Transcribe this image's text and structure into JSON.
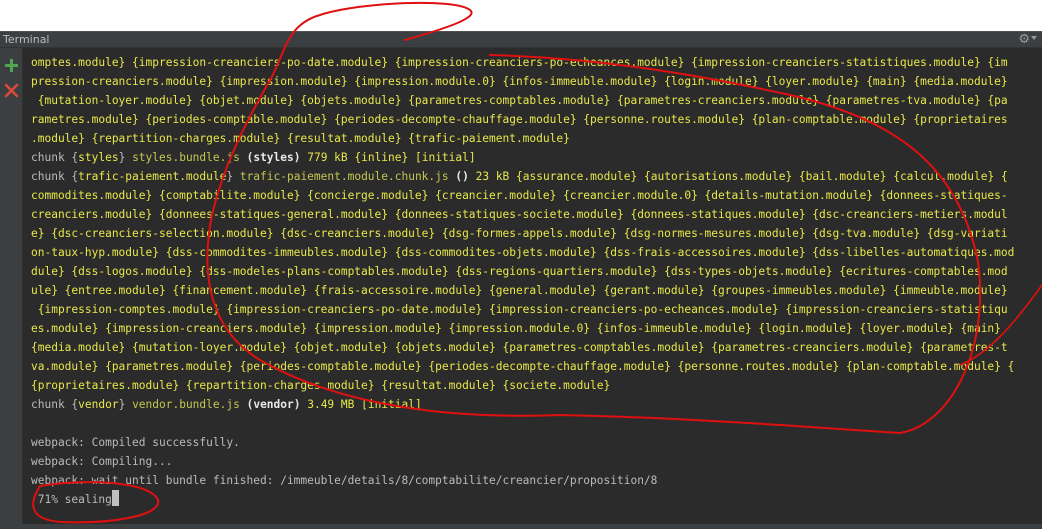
{
  "panel": {
    "title": "Terminal"
  },
  "toolbar": {
    "new_icon": "plus-icon",
    "close_icon": "close-icon",
    "settings_icon": "gear-icon"
  },
  "colors": {
    "terminal_bg": "#2b2b2b",
    "panel_bg": "#3c3f41",
    "module_text": "#e8e84a",
    "plain_text": "#bbbbbb",
    "add_green": "#4ea64e",
    "close_red": "#d94a3a",
    "annotation_red": "#e01010"
  },
  "output": {
    "l01": "omptes.module} {impression-creanciers-po-date.module} {impression-creanciers-po-echeances.module} {impression-creanciers-statistiques.module} {im",
    "l02": "pression-creanciers.module} {impression.module} {impression.module.0} {infos-immeuble.module} {login.module} {loyer.module} {main} {media.module}",
    "l03": " {mutation-loyer.module} {objet.module} {objets.module} {parametres-comptables.module} {parametres-creanciers.module} {parametres-tva.module} {pa",
    "l04": "rametres.module} {periodes-comptable.module} {periodes-decompte-chauffage.module} {personne.routes.module} {plan-comptable.module} {proprietaires",
    "l05": ".module} {repartition-charges.module} {resultat.module} {trafic-paiement.module}",
    "l06": {
      "p1": "chunk {",
      "p2": "styles",
      "p3": "} ",
      "p4": "styles.bundle.js",
      "p5": " ",
      "p6": "(styles)",
      "p7": " 779 kB {inline} [initial]"
    },
    "l07": {
      "p1": "chunk {",
      "p2": "trafic-paiement.module",
      "p3": "} ",
      "p4": "trafic-paiement.module.chunk.js",
      "p5": " ",
      "p6": "()",
      "p7": " 23 kB {assurance.module} {autorisations.module} {bail.module} {calcul.module} {"
    },
    "l08": "commodites.module} {comptabilite.module} {concierge.module} {creancier.module} {creancier.module.0} {details-mutation.module} {donnees-statiques-",
    "l09": "creanciers.module} {donnees-statiques-general.module} {donnees-statiques-societe.module} {donnees-statiques.module} {dsc-creanciers-metiers.modul",
    "l10": "e} {dsc-creanciers-selection.module} {dsc-creanciers.module} {dsg-formes-appels.module} {dsg-normes-mesures.module} {dsg-tva.module} {dsg-variati",
    "l11": "on-taux-hyp.module} {dss-commodites-immeubles.module} {dss-commodites-objets.module} {dss-frais-accessoires.module} {dss-libelles-automatiques.mod",
    "l12": "dule} {dss-logos.module} {dss-modeles-plans-comptables.module} {dss-regions-quartiers.module} {dss-types-objets.module} {ecritures-comptables.mod",
    "l13": "ule} {entree.module} {financement.module} {frais-accessoire.module} {general.module} {gerant.module} {groupes-immeubles.module} {immeuble.module}",
    "l14": " {impression-comptes.module} {impression-creanciers-po-date.module} {impression-creanciers-po-echeances.module} {impression-creanciers-statistiqu",
    "l15": "es.module} {impression-creanciers.module} {impression.module} {impression.module.0} {infos-immeuble.module} {login.module} {loyer.module} {main}",
    "l16": "{media.module} {mutation-loyer.module} {objet.module} {objets.module} {parametres-comptables.module} {parametres-creanciers.module} {parametres-t",
    "l17": "va.module} {parametres.module} {periodes-comptable.module} {periodes-decompte-chauffage.module} {personne.routes.module} {plan-comptable.module} {",
    "l18": "{proprietaires.module} {repartition-charges.module} {resultat.module} {societe.module}",
    "l19": {
      "p1": "chunk {",
      "p2": "vendor",
      "p3": "} ",
      "p4": "vendor.bundle.js",
      "p5": " ",
      "p6": "(vendor)",
      "p7": " 3.49 MB [initial]"
    },
    "l20": "",
    "l21": "webpack: Compiled successfully.",
    "l22": "webpack: Compiling...",
    "l23": "webpack: wait until bundle finished: /immeuble/details/8/comptabilite/creancier/proposition/8",
    "l24": " 71% sealing"
  }
}
